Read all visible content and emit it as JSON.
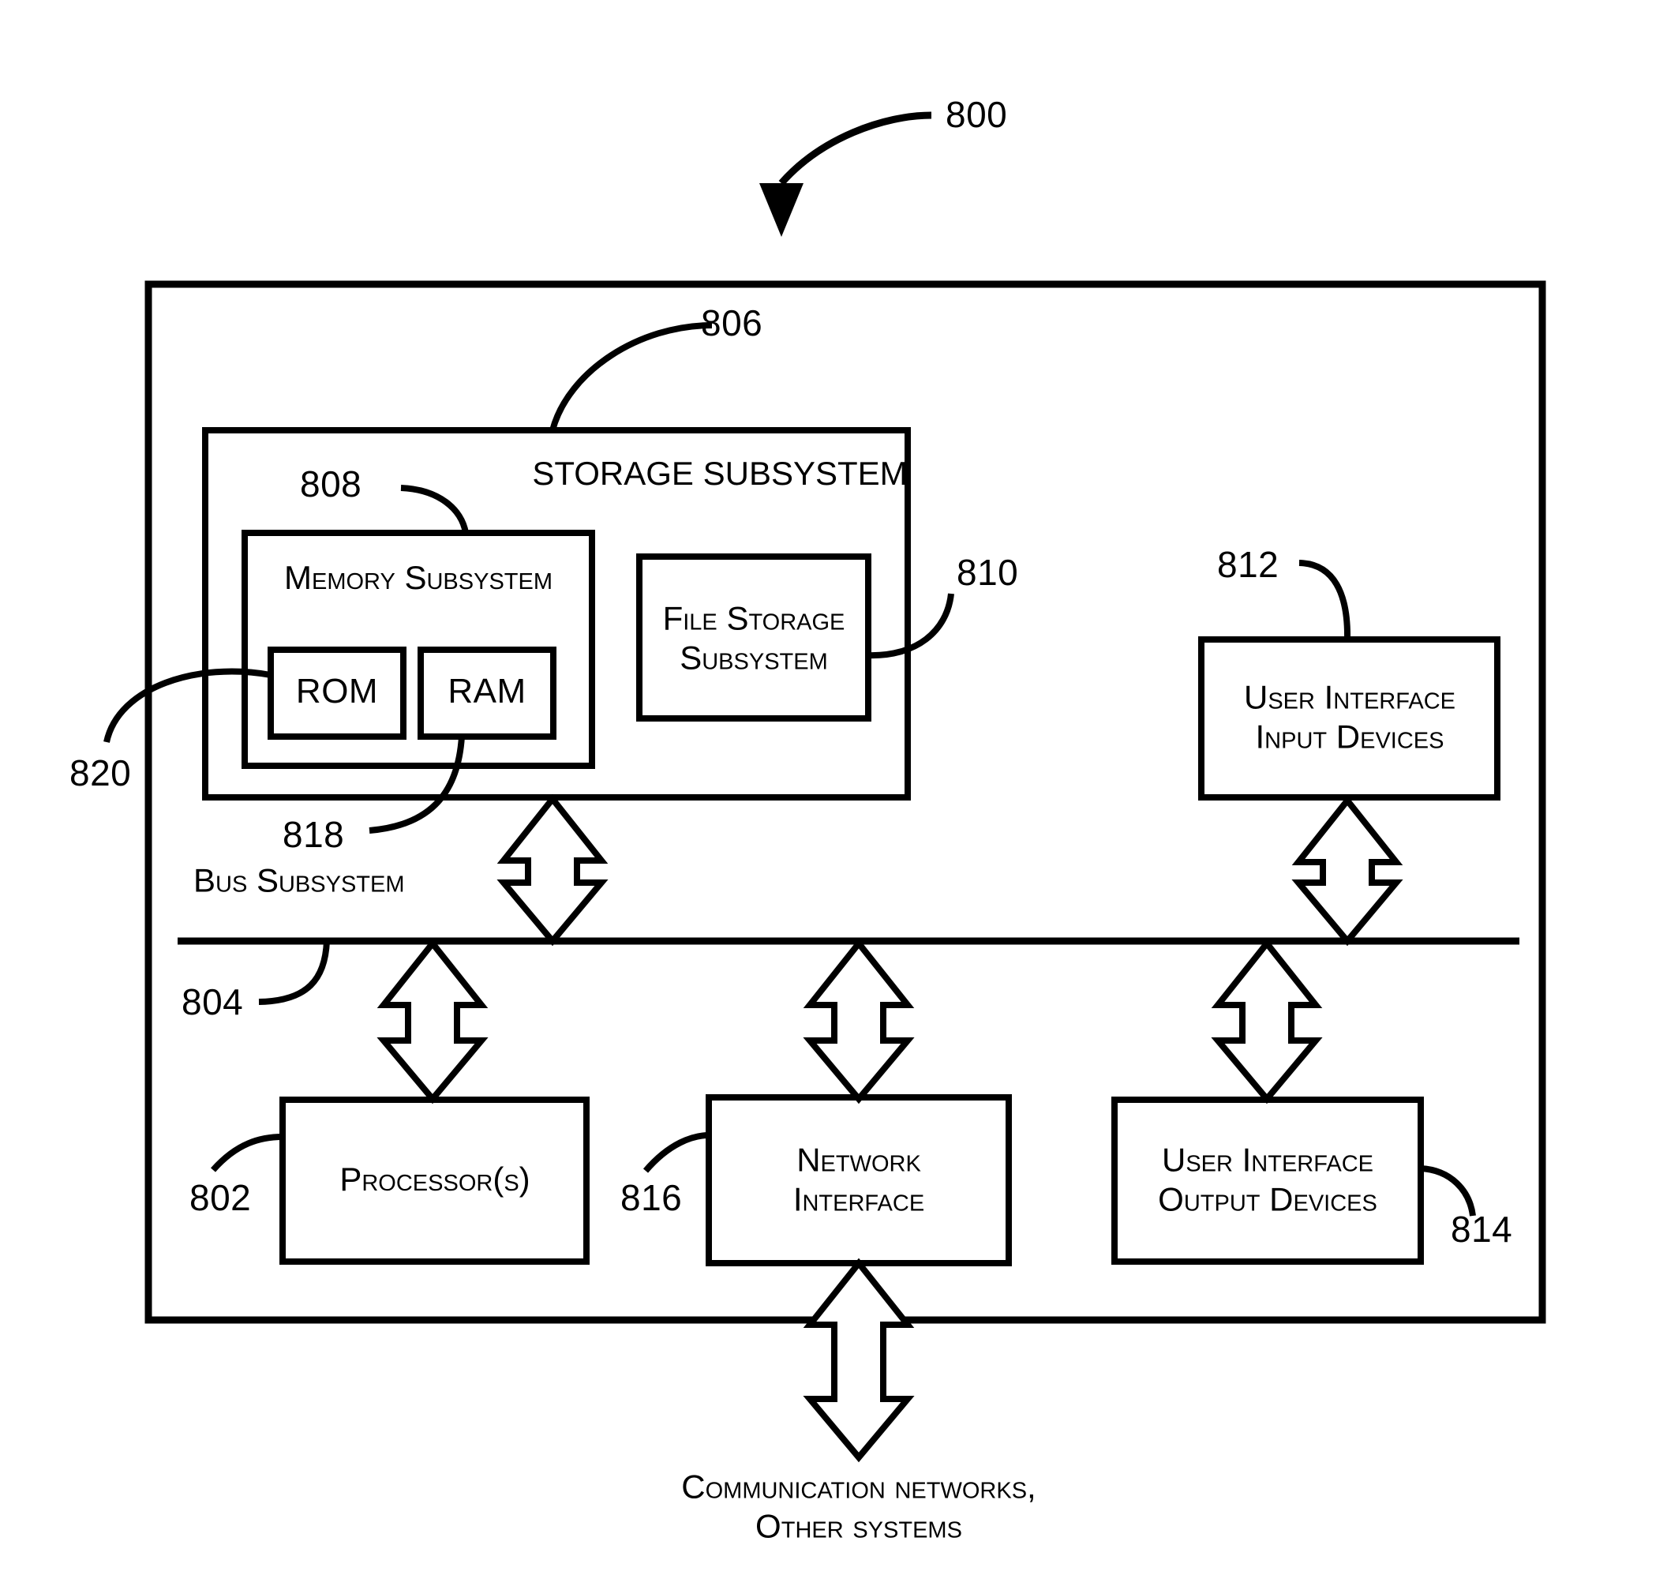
{
  "figure": {
    "top_ref": "800",
    "caption_line1": "Communication networks,",
    "caption_line2": "Other systems"
  },
  "refs": {
    "system": "800",
    "storage_subsystem": "806",
    "memory_subsystem": "808",
    "file_storage_subsystem": "810",
    "ui_input_devices": "812",
    "ui_output_devices": "814",
    "network_interface": "816",
    "ram": "818",
    "rom": "820",
    "bus_subsystem": "804",
    "processors": "802"
  },
  "boxes": {
    "storage_subsystem": {
      "label": "Storage Subsystem"
    },
    "memory_subsystem": {
      "label": "Memory Subsystem"
    },
    "rom": {
      "label": "ROM"
    },
    "ram": {
      "label": "RAM"
    },
    "file_storage_subsystem": {
      "line1": "File Storage",
      "line2": "Subsystem"
    },
    "ui_input_devices": {
      "line1": "User Interface",
      "line2": "Input Devices"
    },
    "ui_output_devices": {
      "line1": "User Interface",
      "line2": "Output Devices"
    },
    "processors": {
      "label": "Processor(s)"
    },
    "network_interface": {
      "line1": "Network",
      "line2": "Interface"
    }
  },
  "bus": {
    "label": "Bus Subsystem"
  },
  "colors": {
    "ink": "#000000",
    "paper": "#ffffff"
  }
}
